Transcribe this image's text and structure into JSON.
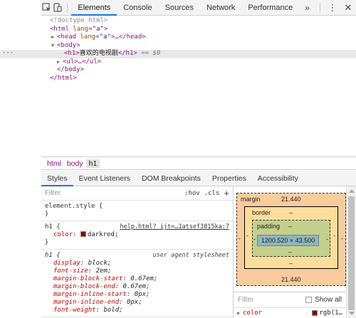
{
  "toolbar": {
    "tabs": [
      "Elements",
      "Console",
      "Sources",
      "Network",
      "Performance"
    ],
    "more": "»",
    "kebab": "⋮",
    "close": "✕",
    "icons": [
      "inspect-icon",
      "device-toolbar-icon"
    ]
  },
  "tree": {
    "doctype": "<!doctype html>",
    "html_open_tag": "<html",
    "html_attr_name": "lang",
    "html_attr_value": "\"a\"",
    "head_open": "<head",
    "head_attr_name": "lang",
    "head_attr_value": "\"a\"",
    "head_rest": ">…</head>",
    "body_open": "<body>",
    "dots": "···",
    "h1_open": "<h1>",
    "h1_text": "喜欢的电视剧",
    "h1_close": "</h1>",
    "h1_eq": "== $0",
    "ul": "<ul>…</ul>",
    "body_close": "</body>",
    "html_close": "</html>"
  },
  "breadcrumbs": [
    "html",
    "body",
    "h1"
  ],
  "subtabs": [
    "Styles",
    "Event Listeners",
    "DOM Breakpoints",
    "Properties",
    "Accessibility"
  ],
  "styles": {
    "filter_placeholder": "Filter",
    "hov": ":hov",
    "cls": ".cls",
    "plus": "+",
    "element_style": {
      "selector": "element.style {",
      "close": "}"
    },
    "h1_rule": {
      "selector": "h1 {",
      "source": "help.html?_ijt=…1atsef3815ka:7",
      "prop": "color",
      "value": "darkred;",
      "swatch_color": "#8b0000",
      "close": "}"
    },
    "ua_rule": {
      "selector": "h1 {",
      "source": "user agent stylesheet",
      "props": [
        {
          "name": "display",
          "value": "block;"
        },
        {
          "name": "font-size",
          "value": "2em;"
        },
        {
          "name": "margin-block-start",
          "value": "0.67em;"
        },
        {
          "name": "margin-block-end",
          "value": "0.67em;"
        },
        {
          "name": "margin-inline-start",
          "value": "0px;"
        },
        {
          "name": "margin-inline-end",
          "value": "0px;"
        },
        {
          "name": "font-weight",
          "value": "bold;"
        }
      ]
    }
  },
  "box_model": {
    "margin_label": "margin",
    "margin_top": "21.440",
    "margin_bottom": "21.440",
    "margin_left": "-",
    "margin_right": "-",
    "border_label": "border",
    "border_top": "–",
    "border_bottom": "–",
    "border_left": "-",
    "border_right": "-",
    "padding_label": "padding",
    "padding_top": "–",
    "padding_bottom": "–",
    "padding_left": "-",
    "padding_right": "-",
    "content": "1200.520 × 43.500"
  },
  "computed": {
    "filter_placeholder": "Filter",
    "show_all": "Show all",
    "row_name": "color",
    "row_value": "rgb(1…",
    "swatch_color": "#8b0000"
  }
}
